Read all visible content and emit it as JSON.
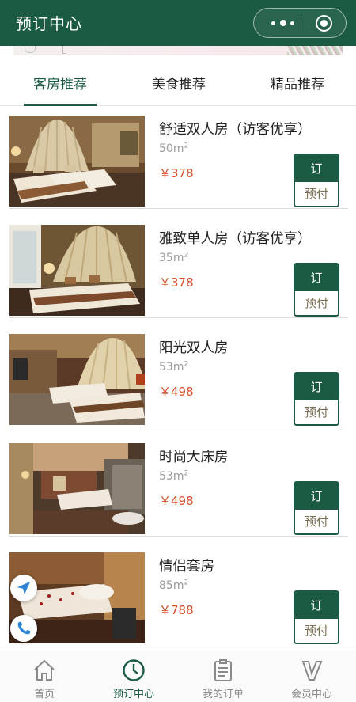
{
  "header": {
    "title": "预订中心"
  },
  "tabs": [
    {
      "label": "客房推荐",
      "active": true
    },
    {
      "label": "美食推荐",
      "active": false
    },
    {
      "label": "精品推荐",
      "active": false
    }
  ],
  "rooms": [
    {
      "name": "舒适双人房（访客优享）",
      "area": "50m",
      "area_unit_sup": "2",
      "price": "￥378",
      "book_label": "订",
      "pay_label": "预付"
    },
    {
      "name": "雅致单人房（访客优享）",
      "area": "35m",
      "area_unit_sup": "2",
      "price": "￥378",
      "book_label": "订",
      "pay_label": "预付"
    },
    {
      "name": "阳光双人房",
      "area": "53m",
      "area_unit_sup": "2",
      "price": "￥498",
      "book_label": "订",
      "pay_label": "预付"
    },
    {
      "name": "时尚大床房",
      "area": "53m",
      "area_unit_sup": "2",
      "price": "￥498",
      "book_label": "订",
      "pay_label": "预付"
    },
    {
      "name": "情侣套房",
      "area": "85m",
      "area_unit_sup": "2",
      "price": "￥788",
      "book_label": "订",
      "pay_label": "预付"
    }
  ],
  "bottom_nav": [
    {
      "label": "首页",
      "icon": "home-icon",
      "active": false
    },
    {
      "label": "预订中心",
      "icon": "clock-icon",
      "active": true
    },
    {
      "label": "我的订单",
      "icon": "clipboard-icon",
      "active": false
    },
    {
      "label": "会员中心",
      "icon": "member-v-icon",
      "active": false
    }
  ],
  "colors": {
    "brand": "#1c5b43",
    "price": "#d9502b",
    "pay_text": "#7a6f52"
  }
}
